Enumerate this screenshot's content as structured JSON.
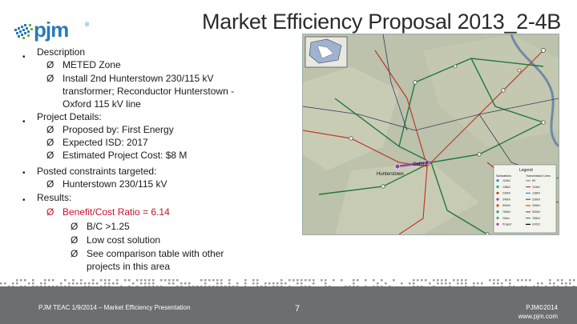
{
  "slide": {
    "title": "Market Efficiency Proposal 2013_2-4B",
    "logo_text": "pjm",
    "logo_tm": "®"
  },
  "content": {
    "bullet_glyph": "•",
    "arrow_glyph": "Ø",
    "l1": "Description",
    "l2": "METED Zone",
    "l3a": "Install 2nd Hunterstown 230/115 kV",
    "l3b": "transformer;  Reconductor Hunterstown -",
    "l3c": "Oxford 115 kV line",
    "l4": "Project Details:",
    "l5": "Proposed by: First Energy",
    "l6": "Expected ISD: 2017",
    "l7": "Estimated Project Cost: $8 M",
    "l8": "Posted constraints targeted:",
    "l9": "Hunterstown 230/115 kV",
    "l10": "Results:",
    "l11": "Benefit/Cost Ratio = 6.14",
    "l12": "B/C >1.25",
    "l13": "Low cost solution",
    "l14a": "See comparison table with other",
    "l14b": "projects in this area"
  },
  "map": {
    "labels": {
      "hunterstown": "Hunterstown",
      "oxford": "Oxford",
      "legend_title": "Legend",
      "legend_left": "Substations",
      "legend_right": "Transmission Lines"
    },
    "legend_items_left": [
      "115kV",
      "138kV",
      "230kV",
      "345kV",
      "500kV",
      "765kV",
      "Other",
      "Project"
    ],
    "legend_items_right": [
      "69",
      "115kV",
      "138kV",
      "230kV",
      "345kV",
      "500kV",
      "765kV",
      "HVDC"
    ],
    "colors": {
      "background": "#b9bfa9",
      "line_230": "#1f7a3a",
      "line_115": "#c0392b",
      "project": "#8e44ad",
      "water": "#6f8aa8"
    }
  },
  "footer": {
    "left_text": "PJM TEAC 1/9/2014 – Market Efficiency Presentation",
    "page": "7",
    "right_line1": "PJM©2014",
    "right_line2": "www.pjm.com"
  },
  "theme": {
    "footer_bg": "#6d6e71",
    "accent_red": "#c8102e",
    "logo_blue": "#2a7ab8"
  }
}
